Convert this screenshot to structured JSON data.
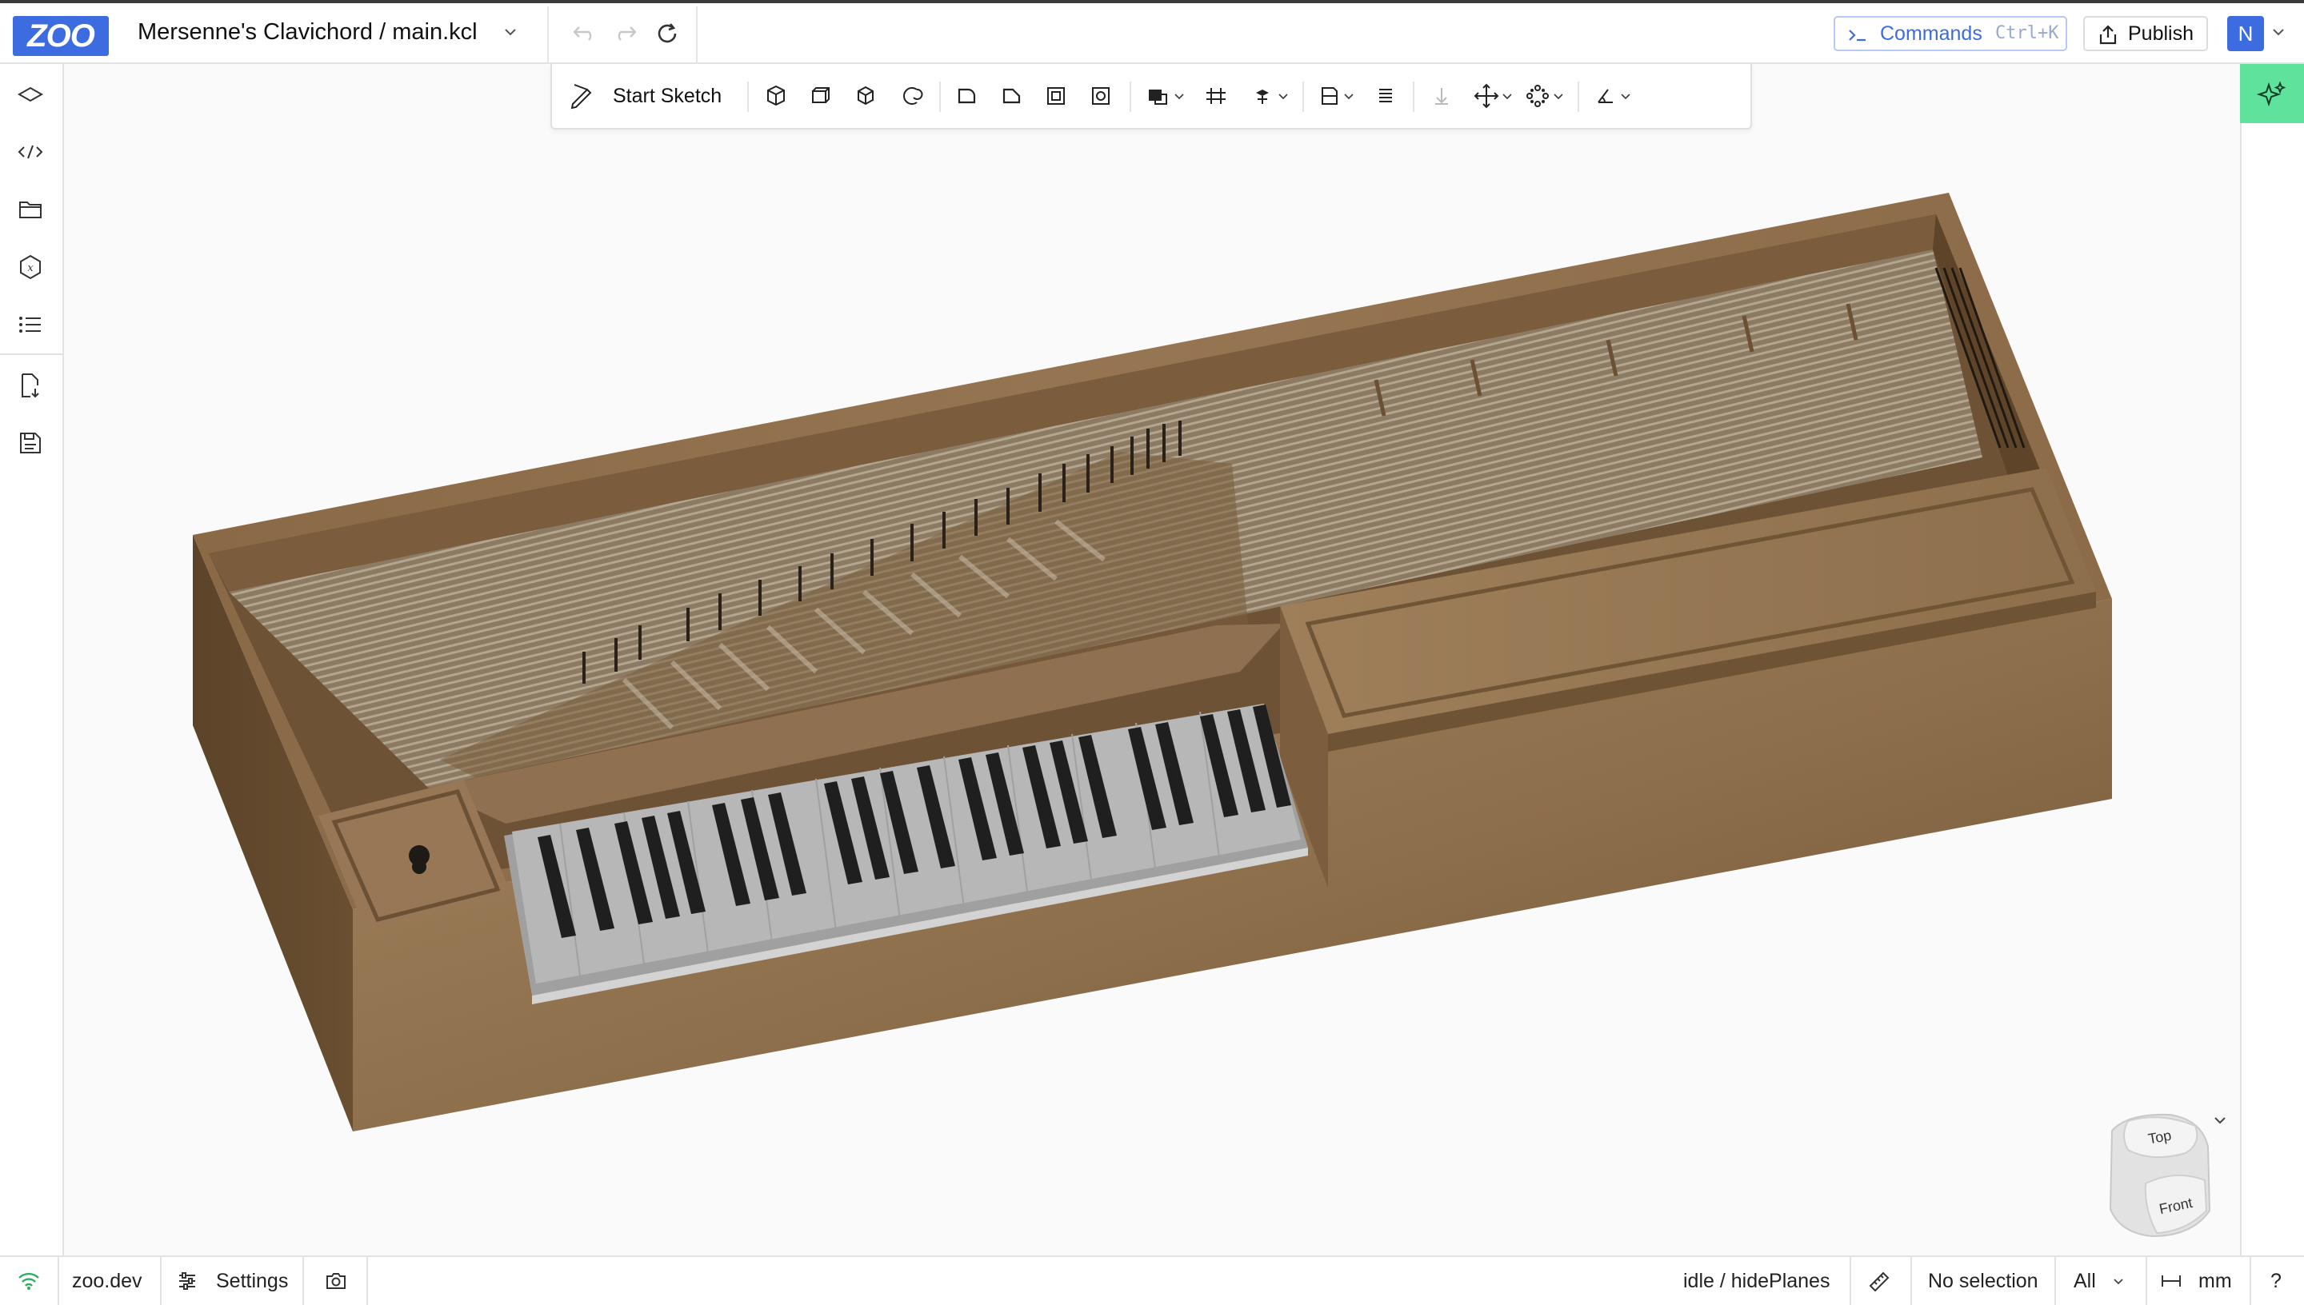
{
  "header": {
    "logo": "ZOO",
    "project_title": "Mersenne's Clavichord / main.kcl",
    "commands_label": "Commands",
    "commands_shortcut": "Ctrl+K",
    "publish_label": "Publish",
    "user_initial": "N",
    "accent": "#3d6be0"
  },
  "toolbar": {
    "start_sketch_label": "Start Sketch",
    "tools": [
      "extrude-icon",
      "revolve-icon",
      "sweep-icon",
      "loft-icon",
      "fillet-icon",
      "chamfer-icon",
      "shell-icon",
      "hole-icon",
      "boolean-icon",
      "offset-plane-icon",
      "helix-icon",
      "insert-icon",
      "split-icon",
      "translate-icon",
      "pattern-icon",
      "measure-angle-icon"
    ]
  },
  "sidebar": {
    "items": [
      "feature-tree-icon",
      "code-icon",
      "files-icon",
      "variables-icon",
      "logs-icon",
      "export-icon",
      "save-icon"
    ]
  },
  "view_cube": {
    "top_label": "Top",
    "front_label": "Front"
  },
  "status": {
    "website": "zoo.dev",
    "settings_label": "Settings",
    "engine_state": "idle / hidePlanes",
    "selection": "No selection",
    "filter": "All",
    "units": "mm",
    "help": "?",
    "network_color": "#2fae62"
  }
}
